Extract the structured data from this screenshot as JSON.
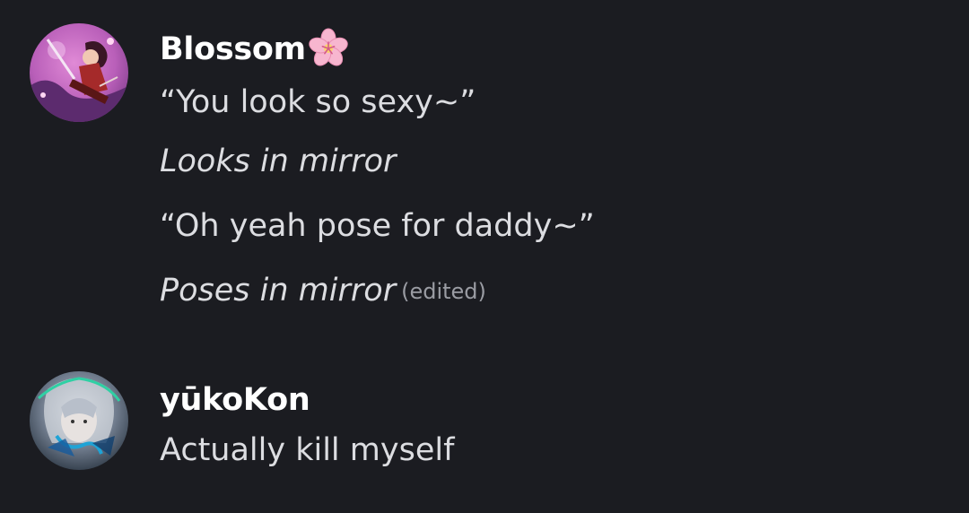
{
  "messages": [
    {
      "author": "Blossom",
      "author_icon": "cherry-blossom-icon",
      "lines": [
        {
          "text": "“You look so sexy~”",
          "style": "normal"
        },
        {
          "text": "Looks in mirror",
          "style": "italic"
        },
        {
          "text": "“Oh yeah pose for daddy~”",
          "style": "normal"
        },
        {
          "text": "Poses in mirror",
          "style": "italic"
        }
      ],
      "edited_label": "(edited)"
    },
    {
      "author": "yūkoKon",
      "lines": [
        {
          "text": "Actually kill myself",
          "style": "normal"
        }
      ]
    }
  ],
  "colors": {
    "background": "#1b1c21",
    "username": "#ffffff",
    "text": "#dcdde1",
    "muted": "#9a9ca3",
    "flower": "#f7b6cf"
  }
}
